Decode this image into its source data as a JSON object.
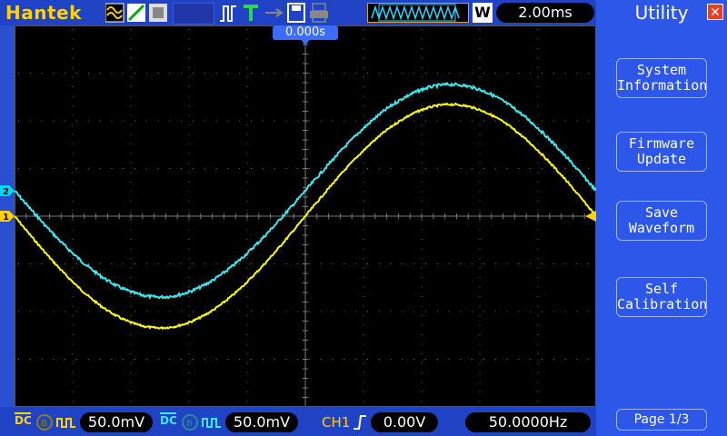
{
  "brand": "Hantek",
  "timebase": "2.00ms",
  "memory_mode": "W",
  "trigger_position": "0.000s",
  "menu": {
    "title": "Utility",
    "items": [
      {
        "line1": "System",
        "line2": "Information"
      },
      {
        "line1": "Firmware",
        "line2": "Update"
      },
      {
        "line1": "Save",
        "line2": "Waveform"
      },
      {
        "line1": "Self",
        "line2": "Calibration"
      }
    ],
    "page": "Page 1/3"
  },
  "ch1": {
    "marker": "1",
    "coupling": "DC",
    "scale": "50.0mV",
    "color": "#ffff00"
  },
  "ch2": {
    "marker": "2",
    "coupling": "DC",
    "scale": "50.0mV",
    "color": "#00ffff"
  },
  "trigger": {
    "source": "CH1",
    "level": "0.00V",
    "frequency": "50.0000Hz"
  },
  "colors": {
    "ch1": "#ffff00",
    "ch2": "#3ee8f0",
    "grid": "#6a6a6a",
    "panel": "#2d57e8"
  }
}
